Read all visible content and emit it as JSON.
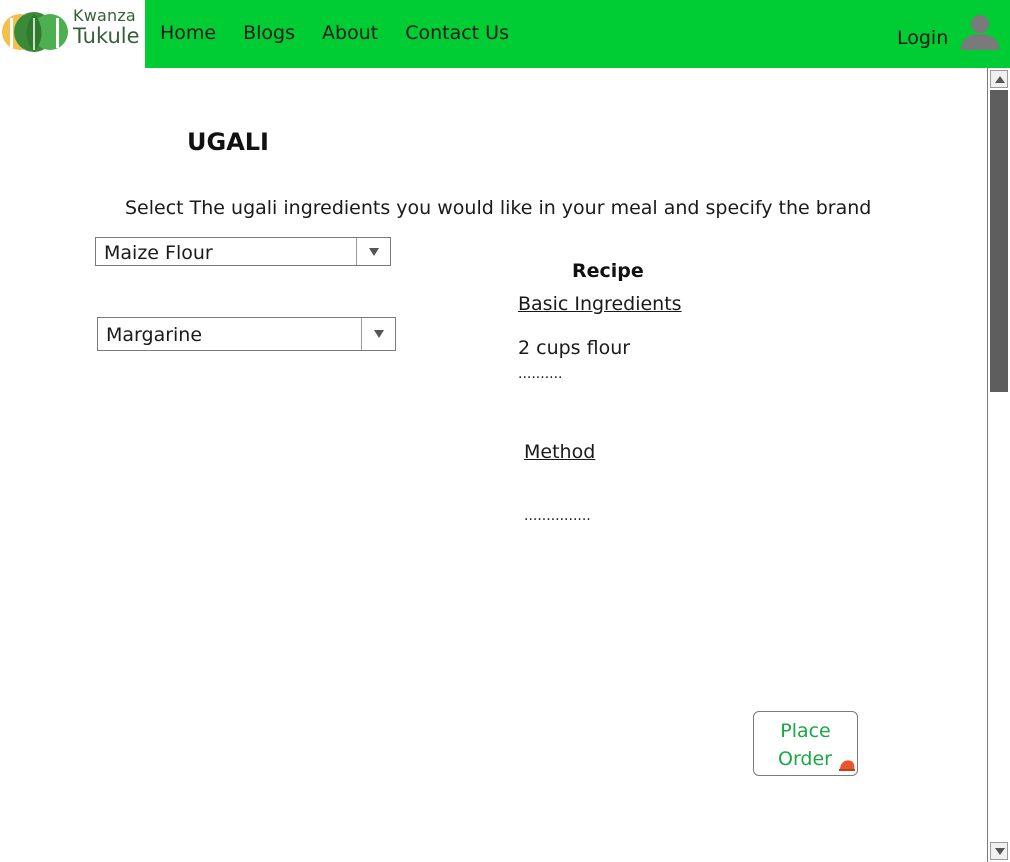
{
  "header": {
    "logo": {
      "line1": "Kwanza",
      "line2": "Tukule"
    },
    "nav": [
      {
        "label": "Home"
      },
      {
        "label": "Blogs"
      },
      {
        "label": "About"
      },
      {
        "label": "Contact Us"
      }
    ],
    "login_label": "Login",
    "user_icon": "user-icon",
    "background_color": "#00cc33"
  },
  "main": {
    "title": "UGALI",
    "instructions": "Select The ugali ingredients you would like in your meal and specify the brand",
    "selects": [
      {
        "value": "Maize Flour"
      },
      {
        "value": "Margarine"
      }
    ],
    "recipe": {
      "title": "Recipe",
      "ingredients_heading": "Basic Ingredients",
      "ingredients_line": "2 cups flour",
      "ingredients_more": "..........",
      "method_heading": "Method",
      "method_more": "..............."
    },
    "order_button": {
      "line1": "Place",
      "line2": "Order",
      "icon": "order-icon"
    }
  },
  "colors": {
    "accent": "#00cc33",
    "button_text": "#1aa843",
    "scroll_thumb": "#5e5e5e"
  }
}
